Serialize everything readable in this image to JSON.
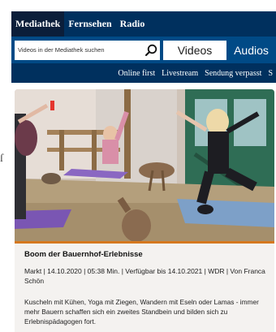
{
  "nav": {
    "items": [
      "Mediathek",
      "Fernsehen",
      "Radio"
    ]
  },
  "search": {
    "placeholder": "Videos in der Mediathek suchen"
  },
  "tabs": {
    "videos": "Videos",
    "audios": "Audios"
  },
  "subnav": {
    "items": [
      "Online first",
      "Livestream",
      "Sendung verpasst"
    ]
  },
  "article": {
    "title": "Boom der Bauernhof-Erlebnisse",
    "meta": "Markt | 14.10.2020 | 05:38 Min. | Verfügbar bis 14.10.2021 | WDR | Von Franca Schön",
    "description": "Kuscheln mit Kühen, Yoga mit Ziegen, Wandern mit Eseln oder Lamas - immer mehr Bauern schaffen sich ein zweites Standbein und bilden sich zu Erlebnispädagogen fort."
  },
  "colors": {
    "nav_dark": "#00305e",
    "nav_blue": "#004a86",
    "accent": "#d5781f"
  }
}
